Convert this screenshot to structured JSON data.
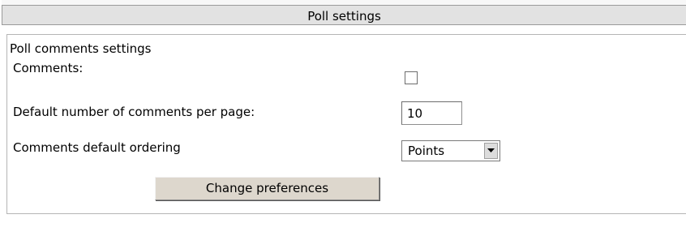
{
  "panel": {
    "title": "Poll settings",
    "section_legend": "Poll comments settings"
  },
  "fields": {
    "comments_label": "Comments:",
    "comments_checked": false,
    "per_page_label": "Default number of comments per page:",
    "per_page_value": "10",
    "ordering_label": "Comments default ordering",
    "ordering_value": "Points"
  },
  "actions": {
    "change_preferences_label": "Change preferences"
  },
  "icons": {
    "select_arrow": "chevron-down-icon"
  }
}
